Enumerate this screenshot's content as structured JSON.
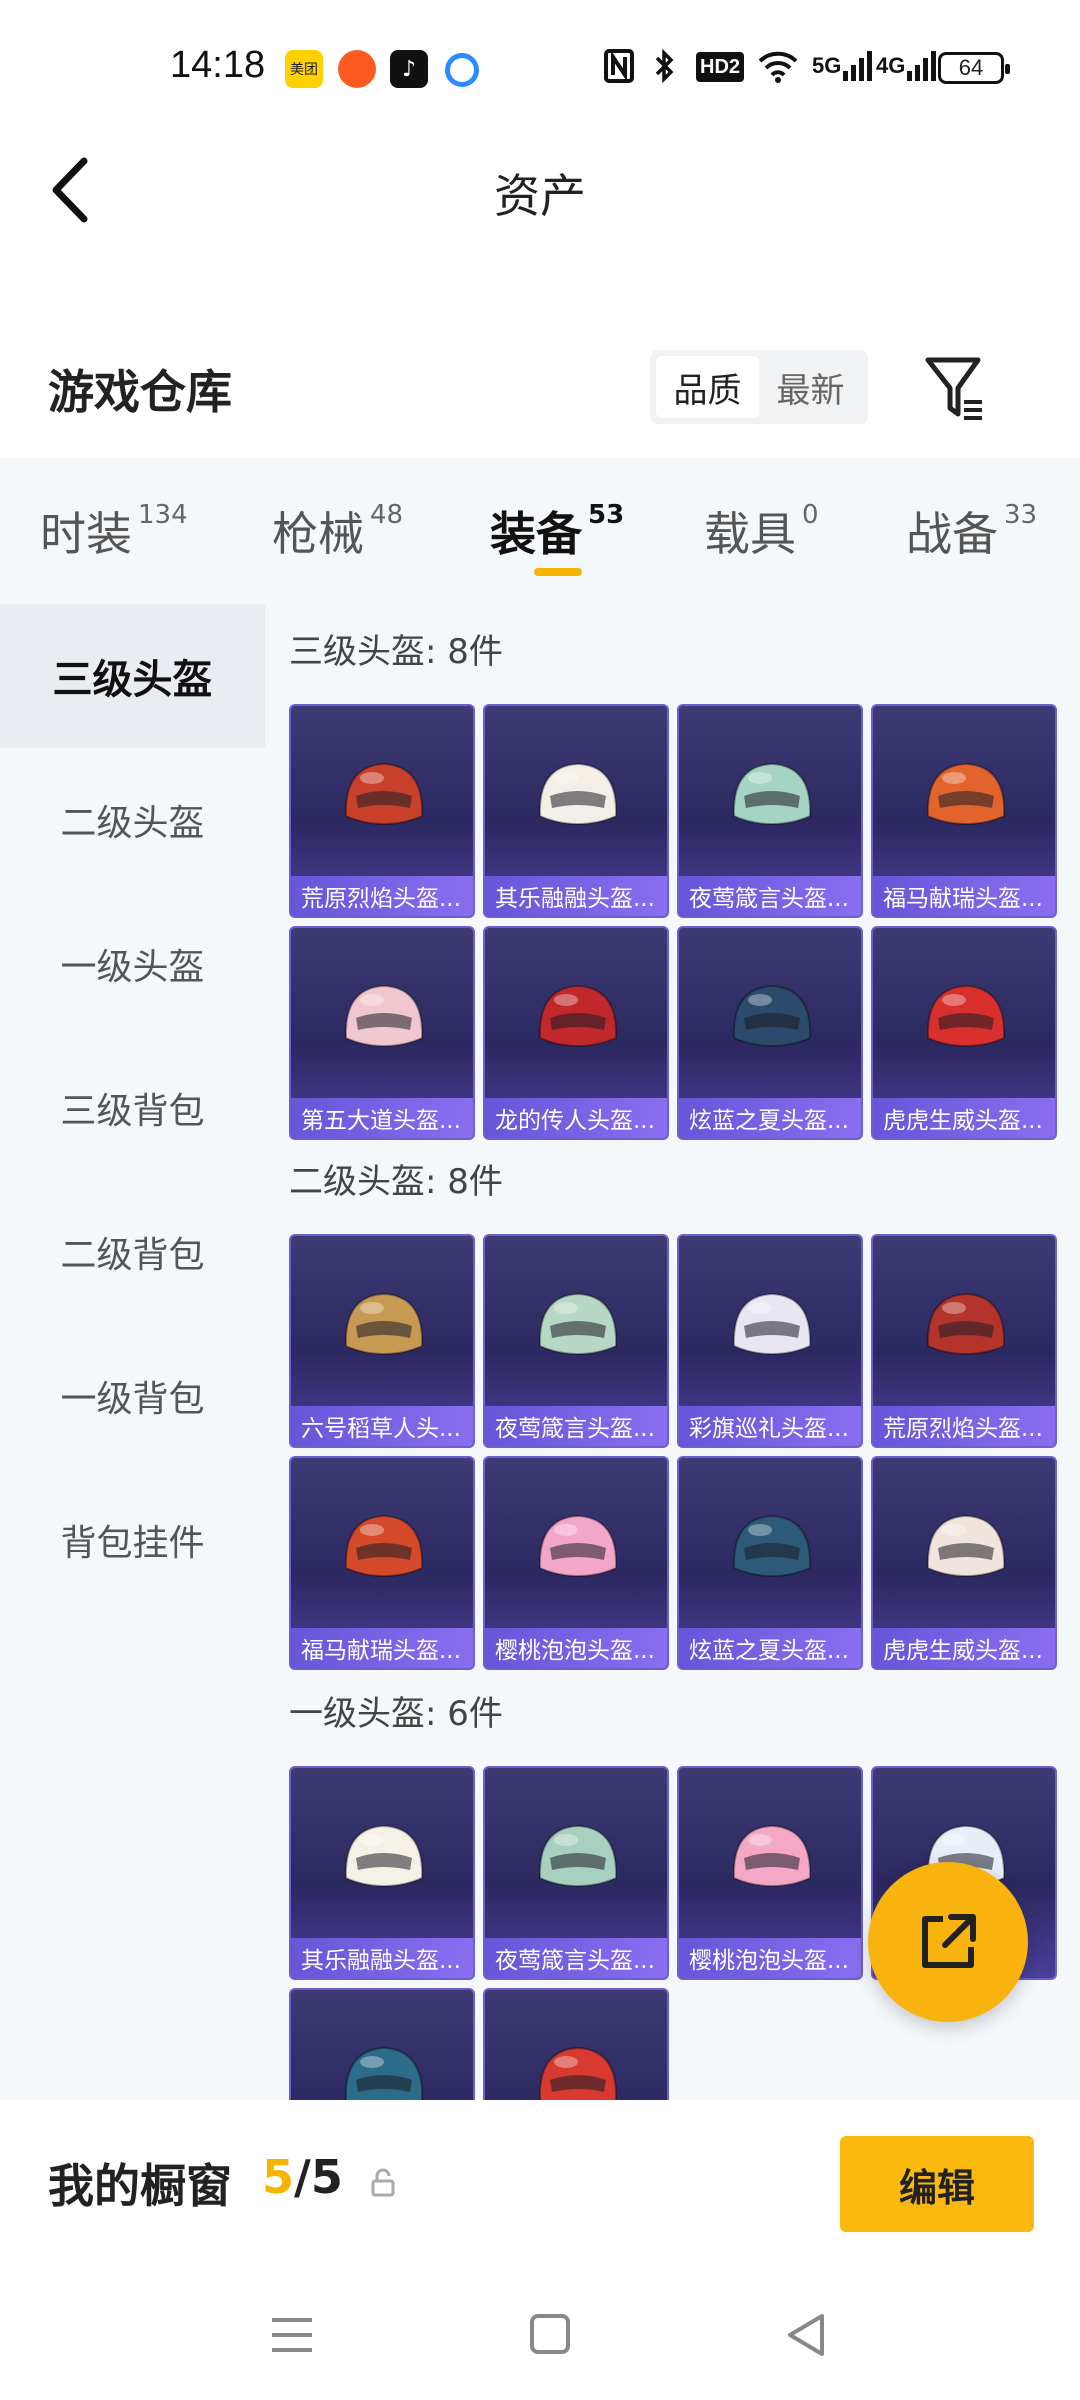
{
  "status_bar": {
    "time": "14:18",
    "icons": [
      "meituan-app-icon",
      "shopping-app-icon",
      "tiktok-app-icon",
      "search-app-icon",
      "nfc-icon",
      "bluetooth-icon",
      "hd-icon",
      "wifi-icon",
      "5g-signal-icon",
      "4g-signal-icon"
    ],
    "meituan_text": "美团",
    "hd_label": "HD2",
    "net1": "5G",
    "net2": "4G",
    "battery": "64"
  },
  "header": {
    "title": "资产"
  },
  "warehouse": {
    "title": "游戏仓库",
    "sort_options": [
      "品质",
      "最新"
    ],
    "sort_selected": "品质"
  },
  "tabs": [
    {
      "label": "时装",
      "count": "134"
    },
    {
      "label": "枪械",
      "count": "48"
    },
    {
      "label": "装备",
      "count": "53"
    },
    {
      "label": "载具",
      "count": "0"
    },
    {
      "label": "战备",
      "count": "33"
    }
  ],
  "active_tab": "装备",
  "sidebar": [
    {
      "label": "三级头盔"
    },
    {
      "label": "二级头盔"
    },
    {
      "label": "一级头盔"
    },
    {
      "label": "三级背包"
    },
    {
      "label": "二级背包"
    },
    {
      "label": "一级背包"
    },
    {
      "label": "背包挂件"
    }
  ],
  "sections": [
    {
      "title": "三级头盔: 8件",
      "items": [
        {
          "name": "荒原烈焰头盔...",
          "color": "#c8402a"
        },
        {
          "name": "其乐融融头盔...",
          "color": "#f3efe6"
        },
        {
          "name": "夜莺箴言头盔...",
          "color": "#a6d4c4"
        },
        {
          "name": "福马献瑞头盔...",
          "color": "#e2642c"
        },
        {
          "name": "第五大道头盔...",
          "color": "#f1c7cf"
        },
        {
          "name": "龙的传人头盔...",
          "color": "#c0282c"
        },
        {
          "name": "炫蓝之夏头盔...",
          "color": "#2c4a6c"
        },
        {
          "name": "虎虎生威头盔...",
          "color": "#d8302c"
        }
      ]
    },
    {
      "title": "二级头盔: 8件",
      "items": [
        {
          "name": "六号稻草人头...",
          "color": "#c79a54"
        },
        {
          "name": "夜莺箴言头盔...",
          "color": "#b6d8c4"
        },
        {
          "name": "彩旗巡礼头盔...",
          "color": "#e8e6f0"
        },
        {
          "name": "荒原烈焰头盔...",
          "color": "#b4342c"
        },
        {
          "name": "福马献瑞头盔...",
          "color": "#d44a2a"
        },
        {
          "name": "樱桃泡泡头盔...",
          "color": "#f2a6c8"
        },
        {
          "name": "炫蓝之夏头盔...",
          "color": "#2c5a78"
        },
        {
          "name": "虎虎生威头盔...",
          "color": "#f0e4dc"
        }
      ]
    },
    {
      "title": "一级头盔: 6件",
      "items": [
        {
          "name": "其乐融融头盔...",
          "color": "#f5f1e6"
        },
        {
          "name": "夜莺箴言头盔...",
          "color": "#a8d0c0"
        },
        {
          "name": "樱桃泡泡头盔...",
          "color": "#f4a8c6"
        },
        {
          "name": "",
          "color": "#e8eef8"
        },
        {
          "name": "",
          "color": "#2c6c88"
        },
        {
          "name": "",
          "color": "#d83a30"
        }
      ]
    }
  ],
  "showcase": {
    "label": "我的橱窗",
    "current": "5",
    "separator": "/",
    "total": "5",
    "edit_label": "编辑"
  },
  "colors": {
    "accent": "#f5b400",
    "card_name_bar": "#7562e4",
    "background": "#f5f8fb"
  }
}
